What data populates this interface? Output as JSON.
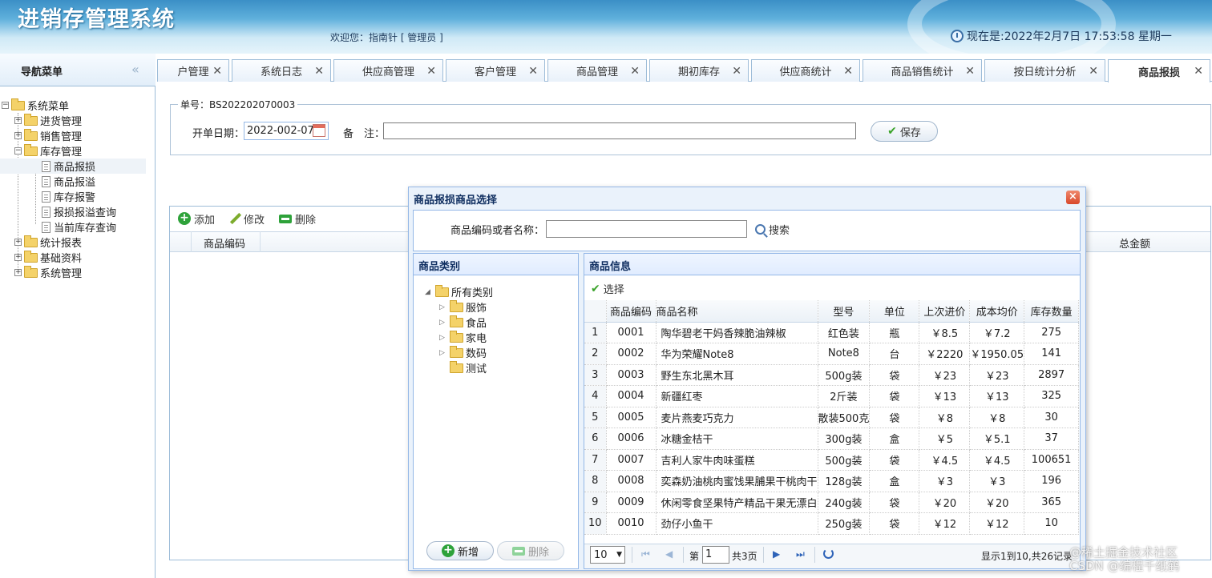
{
  "app": {
    "title": "进销存管理系统",
    "welcome": "欢迎您：指南针 [ 管理员 ]",
    "clock": "现在是:2022年2月7日 17:53:58 星期一"
  },
  "nav": {
    "title": "导航菜单",
    "collapse": "«",
    "root": "系统菜单",
    "items": [
      {
        "label": "进货管理",
        "type": "folder"
      },
      {
        "label": "销售管理",
        "type": "folder"
      },
      {
        "label": "库存管理",
        "type": "folder-open"
      },
      {
        "label": "商品报损",
        "type": "leaf",
        "selected": true
      },
      {
        "label": "商品报溢",
        "type": "leaf"
      },
      {
        "label": "库存报警",
        "type": "leaf"
      },
      {
        "label": "报损报溢查询",
        "type": "leaf"
      },
      {
        "label": "当前库存查询",
        "type": "leaf"
      },
      {
        "label": "统计报表",
        "type": "folder"
      },
      {
        "label": "基础资料",
        "type": "folder"
      },
      {
        "label": "系统管理",
        "type": "folder"
      }
    ]
  },
  "tabs": [
    {
      "label": "户管理"
    },
    {
      "label": "系统日志"
    },
    {
      "label": "供应商管理"
    },
    {
      "label": "客户管理"
    },
    {
      "label": "商品管理"
    },
    {
      "label": "期初库存"
    },
    {
      "label": "供应商统计"
    },
    {
      "label": "商品销售统计"
    },
    {
      "label": "按日统计分析"
    },
    {
      "label": "商品报损",
      "active": true
    }
  ],
  "form": {
    "legend": "单号：BS202202070003",
    "date_label": "开单日期：",
    "date_value": "2022-002-07",
    "remark_label": "备　注：",
    "save_label": "保存"
  },
  "grid": {
    "add": "添加",
    "edit": "修改",
    "delete": "删除",
    "col_code": "商品编码",
    "col_total": "总金额"
  },
  "dialog": {
    "title": "商品报损商品选择",
    "search_label": "商品编码或者名称：",
    "search_button": "搜索",
    "category_title": "商品类别",
    "categories_root": "所有类别",
    "categories": [
      {
        "label": "服饰",
        "expandable": true
      },
      {
        "label": "食品",
        "expandable": true
      },
      {
        "label": "家电",
        "expandable": true
      },
      {
        "label": "数码",
        "expandable": true
      },
      {
        "label": "测试",
        "expandable": false
      }
    ],
    "cat_add": "新增",
    "cat_delete": "删除",
    "product_title": "商品信息",
    "select_label": "选择",
    "columns": [
      "商品编码",
      "商品名称",
      "型号",
      "单位",
      "上次进价",
      "成本均价",
      "库存数量"
    ],
    "rows": [
      [
        "1",
        "0001",
        "陶华碧老干妈香辣脆油辣椒",
        "红色装",
        "瓶",
        "￥8.5",
        "￥7.2",
        "275"
      ],
      [
        "2",
        "0002",
        "华为荣耀Note8",
        "Note8",
        "台",
        "￥2220",
        "￥1950.05",
        "141"
      ],
      [
        "3",
        "0003",
        "野生东北黑木耳",
        "500g装",
        "袋",
        "￥23",
        "￥23",
        "2897"
      ],
      [
        "4",
        "0004",
        "新疆红枣",
        "2斤装",
        "袋",
        "￥13",
        "￥13",
        "325"
      ],
      [
        "5",
        "0005",
        "麦片燕麦巧克力",
        "散装500克",
        "袋",
        "￥8",
        "￥8",
        "30"
      ],
      [
        "6",
        "0006",
        "冰糖金桔干",
        "300g装",
        "盒",
        "￥5",
        "￥5.1",
        "37"
      ],
      [
        "7",
        "0007",
        "吉利人家牛肉味蛋糕",
        "500g装",
        "袋",
        "￥4.5",
        "￥4.5",
        "100651"
      ],
      [
        "8",
        "0008",
        "奕森奶油桃肉蜜饯果脯果干桃肉干",
        "128g装",
        "盒",
        "￥3",
        "￥3",
        "196"
      ],
      [
        "9",
        "0009",
        "休闲零食坚果特产精品干果无漂白",
        "240g装",
        "袋",
        "￥20",
        "￥20",
        "365"
      ],
      [
        "10",
        "0010",
        "劲仔小鱼干",
        "250g装",
        "袋",
        "￥12",
        "￥12",
        "10"
      ]
    ],
    "pager": {
      "page_size": "10",
      "page_label": "第",
      "page_value": "1",
      "page_total": "共3页",
      "info": "显示1到10,共26记录"
    }
  },
  "watermark": "@稀土掘金技术社区\nCSDN @编程千纸鹤"
}
